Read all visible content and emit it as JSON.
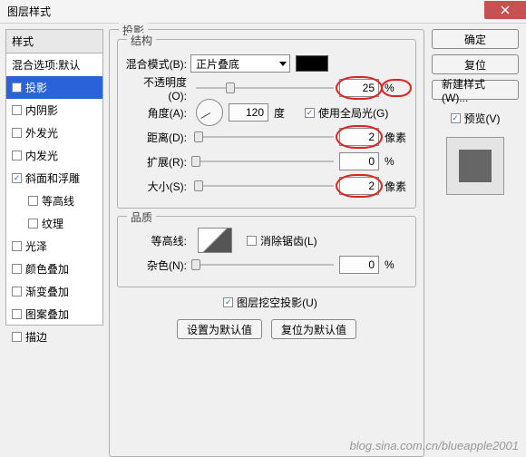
{
  "title": "图层样式",
  "close_glyph": "✕",
  "sidebar": {
    "header": "样式",
    "items": [
      {
        "label": "混合选项:默认",
        "checkbox": false,
        "checked": false,
        "selected": false,
        "indent": false
      },
      {
        "label": "投影",
        "checkbox": true,
        "checked": true,
        "selected": true,
        "indent": false
      },
      {
        "label": "内阴影",
        "checkbox": true,
        "checked": false,
        "selected": false,
        "indent": false
      },
      {
        "label": "外发光",
        "checkbox": true,
        "checked": false,
        "selected": false,
        "indent": false
      },
      {
        "label": "内发光",
        "checkbox": true,
        "checked": false,
        "selected": false,
        "indent": false
      },
      {
        "label": "斜面和浮雕",
        "checkbox": true,
        "checked": true,
        "selected": false,
        "indent": false
      },
      {
        "label": "等高线",
        "checkbox": true,
        "checked": false,
        "selected": false,
        "indent": true
      },
      {
        "label": "纹理",
        "checkbox": true,
        "checked": false,
        "selected": false,
        "indent": true
      },
      {
        "label": "光泽",
        "checkbox": true,
        "checked": false,
        "selected": false,
        "indent": false
      },
      {
        "label": "颜色叠加",
        "checkbox": true,
        "checked": false,
        "selected": false,
        "indent": false
      },
      {
        "label": "渐变叠加",
        "checkbox": true,
        "checked": false,
        "selected": false,
        "indent": false
      },
      {
        "label": "图案叠加",
        "checkbox": true,
        "checked": false,
        "selected": false,
        "indent": false
      },
      {
        "label": "描边",
        "checkbox": true,
        "checked": false,
        "selected": false,
        "indent": false
      }
    ]
  },
  "main": {
    "title": "投影",
    "structure": {
      "title": "结构",
      "blend_mode_label": "混合模式(B):",
      "blend_mode_value": "正片叠底",
      "opacity_label": "不透明度(O):",
      "opacity_value": "25",
      "opacity_unit": "%",
      "angle_label": "角度(A):",
      "angle_value": "120",
      "angle_unit": "度",
      "use_global_label": "使用全局光(G)",
      "use_global_checked": true,
      "distance_label": "距离(D):",
      "distance_value": "2",
      "distance_unit": "像素",
      "spread_label": "扩展(R):",
      "spread_value": "0",
      "spread_unit": "%",
      "size_label": "大小(S):",
      "size_value": "2",
      "size_unit": "像素"
    },
    "quality": {
      "title": "品质",
      "contour_label": "等高线:",
      "antialias_label": "消除锯齿(L)",
      "antialias_checked": false,
      "noise_label": "杂色(N):",
      "noise_value": "0",
      "noise_unit": "%"
    },
    "knockout_label": "图层挖空投影(U)",
    "knockout_checked": true,
    "set_default": "设置为默认值",
    "reset_default": "复位为默认值"
  },
  "right": {
    "ok": "确定",
    "reset": "复位",
    "new_style": "新建样式(W)...",
    "preview_label": "预览(V)",
    "preview_checked": true
  },
  "watermark": "blog.sina.com.cn/blueapple2001"
}
